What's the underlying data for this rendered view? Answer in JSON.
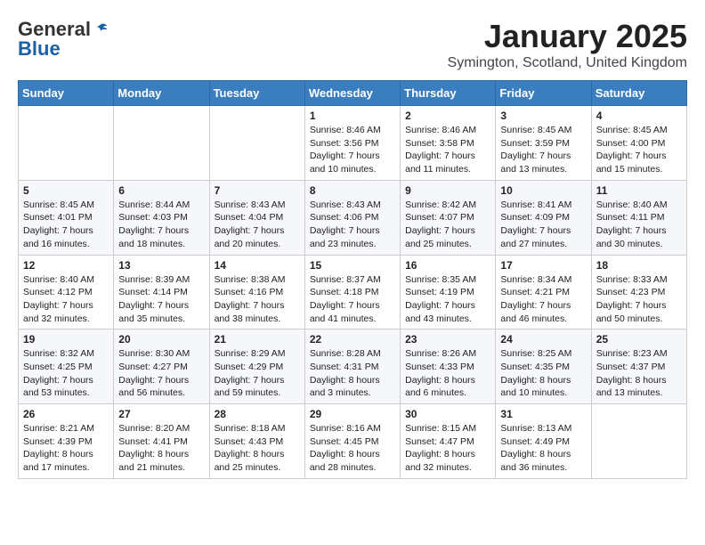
{
  "logo": {
    "general": "General",
    "blue": "Blue"
  },
  "title": "January 2025",
  "subtitle": "Symington, Scotland, United Kingdom",
  "weekdays": [
    "Sunday",
    "Monday",
    "Tuesday",
    "Wednesday",
    "Thursday",
    "Friday",
    "Saturday"
  ],
  "weeks": [
    [
      {
        "day": "",
        "sunrise": "",
        "sunset": "",
        "daylight": ""
      },
      {
        "day": "",
        "sunrise": "",
        "sunset": "",
        "daylight": ""
      },
      {
        "day": "",
        "sunrise": "",
        "sunset": "",
        "daylight": ""
      },
      {
        "day": "1",
        "sunrise": "Sunrise: 8:46 AM",
        "sunset": "Sunset: 3:56 PM",
        "daylight": "Daylight: 7 hours and 10 minutes."
      },
      {
        "day": "2",
        "sunrise": "Sunrise: 8:46 AM",
        "sunset": "Sunset: 3:58 PM",
        "daylight": "Daylight: 7 hours and 11 minutes."
      },
      {
        "day": "3",
        "sunrise": "Sunrise: 8:45 AM",
        "sunset": "Sunset: 3:59 PM",
        "daylight": "Daylight: 7 hours and 13 minutes."
      },
      {
        "day": "4",
        "sunrise": "Sunrise: 8:45 AM",
        "sunset": "Sunset: 4:00 PM",
        "daylight": "Daylight: 7 hours and 15 minutes."
      }
    ],
    [
      {
        "day": "5",
        "sunrise": "Sunrise: 8:45 AM",
        "sunset": "Sunset: 4:01 PM",
        "daylight": "Daylight: 7 hours and 16 minutes."
      },
      {
        "day": "6",
        "sunrise": "Sunrise: 8:44 AM",
        "sunset": "Sunset: 4:03 PM",
        "daylight": "Daylight: 7 hours and 18 minutes."
      },
      {
        "day": "7",
        "sunrise": "Sunrise: 8:43 AM",
        "sunset": "Sunset: 4:04 PM",
        "daylight": "Daylight: 7 hours and 20 minutes."
      },
      {
        "day": "8",
        "sunrise": "Sunrise: 8:43 AM",
        "sunset": "Sunset: 4:06 PM",
        "daylight": "Daylight: 7 hours and 23 minutes."
      },
      {
        "day": "9",
        "sunrise": "Sunrise: 8:42 AM",
        "sunset": "Sunset: 4:07 PM",
        "daylight": "Daylight: 7 hours and 25 minutes."
      },
      {
        "day": "10",
        "sunrise": "Sunrise: 8:41 AM",
        "sunset": "Sunset: 4:09 PM",
        "daylight": "Daylight: 7 hours and 27 minutes."
      },
      {
        "day": "11",
        "sunrise": "Sunrise: 8:40 AM",
        "sunset": "Sunset: 4:11 PM",
        "daylight": "Daylight: 7 hours and 30 minutes."
      }
    ],
    [
      {
        "day": "12",
        "sunrise": "Sunrise: 8:40 AM",
        "sunset": "Sunset: 4:12 PM",
        "daylight": "Daylight: 7 hours and 32 minutes."
      },
      {
        "day": "13",
        "sunrise": "Sunrise: 8:39 AM",
        "sunset": "Sunset: 4:14 PM",
        "daylight": "Daylight: 7 hours and 35 minutes."
      },
      {
        "day": "14",
        "sunrise": "Sunrise: 8:38 AM",
        "sunset": "Sunset: 4:16 PM",
        "daylight": "Daylight: 7 hours and 38 minutes."
      },
      {
        "day": "15",
        "sunrise": "Sunrise: 8:37 AM",
        "sunset": "Sunset: 4:18 PM",
        "daylight": "Daylight: 7 hours and 41 minutes."
      },
      {
        "day": "16",
        "sunrise": "Sunrise: 8:35 AM",
        "sunset": "Sunset: 4:19 PM",
        "daylight": "Daylight: 7 hours and 43 minutes."
      },
      {
        "day": "17",
        "sunrise": "Sunrise: 8:34 AM",
        "sunset": "Sunset: 4:21 PM",
        "daylight": "Daylight: 7 hours and 46 minutes."
      },
      {
        "day": "18",
        "sunrise": "Sunrise: 8:33 AM",
        "sunset": "Sunset: 4:23 PM",
        "daylight": "Daylight: 7 hours and 50 minutes."
      }
    ],
    [
      {
        "day": "19",
        "sunrise": "Sunrise: 8:32 AM",
        "sunset": "Sunset: 4:25 PM",
        "daylight": "Daylight: 7 hours and 53 minutes."
      },
      {
        "day": "20",
        "sunrise": "Sunrise: 8:30 AM",
        "sunset": "Sunset: 4:27 PM",
        "daylight": "Daylight: 7 hours and 56 minutes."
      },
      {
        "day": "21",
        "sunrise": "Sunrise: 8:29 AM",
        "sunset": "Sunset: 4:29 PM",
        "daylight": "Daylight: 7 hours and 59 minutes."
      },
      {
        "day": "22",
        "sunrise": "Sunrise: 8:28 AM",
        "sunset": "Sunset: 4:31 PM",
        "daylight": "Daylight: 8 hours and 3 minutes."
      },
      {
        "day": "23",
        "sunrise": "Sunrise: 8:26 AM",
        "sunset": "Sunset: 4:33 PM",
        "daylight": "Daylight: 8 hours and 6 minutes."
      },
      {
        "day": "24",
        "sunrise": "Sunrise: 8:25 AM",
        "sunset": "Sunset: 4:35 PM",
        "daylight": "Daylight: 8 hours and 10 minutes."
      },
      {
        "day": "25",
        "sunrise": "Sunrise: 8:23 AM",
        "sunset": "Sunset: 4:37 PM",
        "daylight": "Daylight: 8 hours and 13 minutes."
      }
    ],
    [
      {
        "day": "26",
        "sunrise": "Sunrise: 8:21 AM",
        "sunset": "Sunset: 4:39 PM",
        "daylight": "Daylight: 8 hours and 17 minutes."
      },
      {
        "day": "27",
        "sunrise": "Sunrise: 8:20 AM",
        "sunset": "Sunset: 4:41 PM",
        "daylight": "Daylight: 8 hours and 21 minutes."
      },
      {
        "day": "28",
        "sunrise": "Sunrise: 8:18 AM",
        "sunset": "Sunset: 4:43 PM",
        "daylight": "Daylight: 8 hours and 25 minutes."
      },
      {
        "day": "29",
        "sunrise": "Sunrise: 8:16 AM",
        "sunset": "Sunset: 4:45 PM",
        "daylight": "Daylight: 8 hours and 28 minutes."
      },
      {
        "day": "30",
        "sunrise": "Sunrise: 8:15 AM",
        "sunset": "Sunset: 4:47 PM",
        "daylight": "Daylight: 8 hours and 32 minutes."
      },
      {
        "day": "31",
        "sunrise": "Sunrise: 8:13 AM",
        "sunset": "Sunset: 4:49 PM",
        "daylight": "Daylight: 8 hours and 36 minutes."
      },
      {
        "day": "",
        "sunrise": "",
        "sunset": "",
        "daylight": ""
      }
    ]
  ]
}
